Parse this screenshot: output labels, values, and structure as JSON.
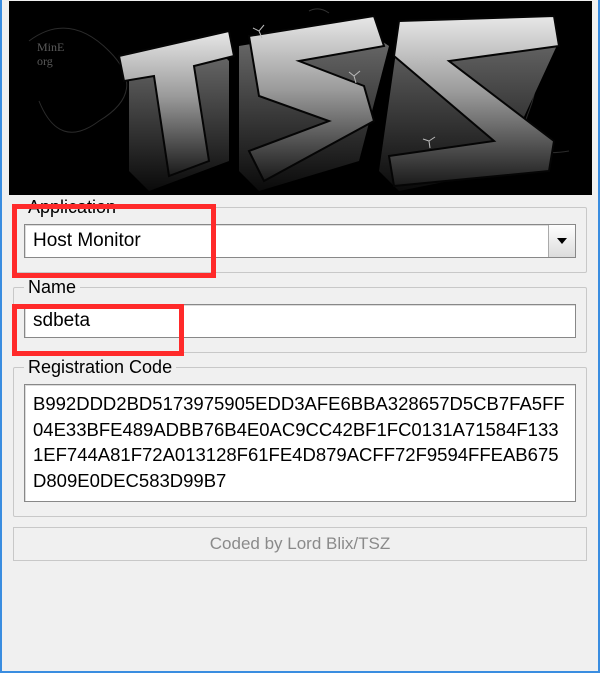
{
  "banner": {
    "logo_text": "TSZ",
    "tag_small": "Mine\nOrg"
  },
  "application": {
    "legend": "Application",
    "selected": "Host Monitor"
  },
  "name": {
    "legend": "Name",
    "value": "sdbeta"
  },
  "registration": {
    "legend": "Registration Code",
    "code": "B992DDD2BD5173975905EDD3AFE6BBA328657D5CB7FA5FF04E33BFE489ADBB76B4E0AC9CC42BF1FC0131A71584F1331EF744A81F72A013128F61FE4D879ACFF72F9594FFEAB675D809E0DEC583D99B7"
  },
  "footer": {
    "credit": "Coded by Lord Blix/TSZ"
  },
  "colors": {
    "highlight": "#ff2a2a",
    "window_border": "#3a8de0"
  }
}
